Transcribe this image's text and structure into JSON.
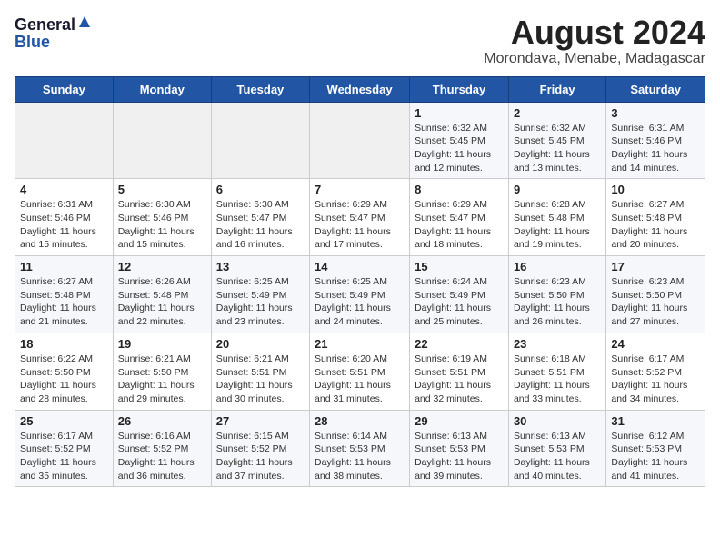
{
  "logo": {
    "general": "General",
    "blue": "Blue"
  },
  "title": "August 2024",
  "subtitle": "Morondava, Menabe, Madagascar",
  "headers": [
    "Sunday",
    "Monday",
    "Tuesday",
    "Wednesday",
    "Thursday",
    "Friday",
    "Saturday"
  ],
  "weeks": [
    [
      {
        "num": "",
        "info": ""
      },
      {
        "num": "",
        "info": ""
      },
      {
        "num": "",
        "info": ""
      },
      {
        "num": "",
        "info": ""
      },
      {
        "num": "1",
        "info": "Sunrise: 6:32 AM\nSunset: 5:45 PM\nDaylight: 11 hours and 12 minutes."
      },
      {
        "num": "2",
        "info": "Sunrise: 6:32 AM\nSunset: 5:45 PM\nDaylight: 11 hours and 13 minutes."
      },
      {
        "num": "3",
        "info": "Sunrise: 6:31 AM\nSunset: 5:46 PM\nDaylight: 11 hours and 14 minutes."
      }
    ],
    [
      {
        "num": "4",
        "info": "Sunrise: 6:31 AM\nSunset: 5:46 PM\nDaylight: 11 hours and 15 minutes."
      },
      {
        "num": "5",
        "info": "Sunrise: 6:30 AM\nSunset: 5:46 PM\nDaylight: 11 hours and 15 minutes."
      },
      {
        "num": "6",
        "info": "Sunrise: 6:30 AM\nSunset: 5:47 PM\nDaylight: 11 hours and 16 minutes."
      },
      {
        "num": "7",
        "info": "Sunrise: 6:29 AM\nSunset: 5:47 PM\nDaylight: 11 hours and 17 minutes."
      },
      {
        "num": "8",
        "info": "Sunrise: 6:29 AM\nSunset: 5:47 PM\nDaylight: 11 hours and 18 minutes."
      },
      {
        "num": "9",
        "info": "Sunrise: 6:28 AM\nSunset: 5:48 PM\nDaylight: 11 hours and 19 minutes."
      },
      {
        "num": "10",
        "info": "Sunrise: 6:27 AM\nSunset: 5:48 PM\nDaylight: 11 hours and 20 minutes."
      }
    ],
    [
      {
        "num": "11",
        "info": "Sunrise: 6:27 AM\nSunset: 5:48 PM\nDaylight: 11 hours and 21 minutes."
      },
      {
        "num": "12",
        "info": "Sunrise: 6:26 AM\nSunset: 5:48 PM\nDaylight: 11 hours and 22 minutes."
      },
      {
        "num": "13",
        "info": "Sunrise: 6:25 AM\nSunset: 5:49 PM\nDaylight: 11 hours and 23 minutes."
      },
      {
        "num": "14",
        "info": "Sunrise: 6:25 AM\nSunset: 5:49 PM\nDaylight: 11 hours and 24 minutes."
      },
      {
        "num": "15",
        "info": "Sunrise: 6:24 AM\nSunset: 5:49 PM\nDaylight: 11 hours and 25 minutes."
      },
      {
        "num": "16",
        "info": "Sunrise: 6:23 AM\nSunset: 5:50 PM\nDaylight: 11 hours and 26 minutes."
      },
      {
        "num": "17",
        "info": "Sunrise: 6:23 AM\nSunset: 5:50 PM\nDaylight: 11 hours and 27 minutes."
      }
    ],
    [
      {
        "num": "18",
        "info": "Sunrise: 6:22 AM\nSunset: 5:50 PM\nDaylight: 11 hours and 28 minutes."
      },
      {
        "num": "19",
        "info": "Sunrise: 6:21 AM\nSunset: 5:50 PM\nDaylight: 11 hours and 29 minutes."
      },
      {
        "num": "20",
        "info": "Sunrise: 6:21 AM\nSunset: 5:51 PM\nDaylight: 11 hours and 30 minutes."
      },
      {
        "num": "21",
        "info": "Sunrise: 6:20 AM\nSunset: 5:51 PM\nDaylight: 11 hours and 31 minutes."
      },
      {
        "num": "22",
        "info": "Sunrise: 6:19 AM\nSunset: 5:51 PM\nDaylight: 11 hours and 32 minutes."
      },
      {
        "num": "23",
        "info": "Sunrise: 6:18 AM\nSunset: 5:51 PM\nDaylight: 11 hours and 33 minutes."
      },
      {
        "num": "24",
        "info": "Sunrise: 6:17 AM\nSunset: 5:52 PM\nDaylight: 11 hours and 34 minutes."
      }
    ],
    [
      {
        "num": "25",
        "info": "Sunrise: 6:17 AM\nSunset: 5:52 PM\nDaylight: 11 hours and 35 minutes."
      },
      {
        "num": "26",
        "info": "Sunrise: 6:16 AM\nSunset: 5:52 PM\nDaylight: 11 hours and 36 minutes."
      },
      {
        "num": "27",
        "info": "Sunrise: 6:15 AM\nSunset: 5:52 PM\nDaylight: 11 hours and 37 minutes."
      },
      {
        "num": "28",
        "info": "Sunrise: 6:14 AM\nSunset: 5:53 PM\nDaylight: 11 hours and 38 minutes."
      },
      {
        "num": "29",
        "info": "Sunrise: 6:13 AM\nSunset: 5:53 PM\nDaylight: 11 hours and 39 minutes."
      },
      {
        "num": "30",
        "info": "Sunrise: 6:13 AM\nSunset: 5:53 PM\nDaylight: 11 hours and 40 minutes."
      },
      {
        "num": "31",
        "info": "Sunrise: 6:12 AM\nSunset: 5:53 PM\nDaylight: 11 hours and 41 minutes."
      }
    ]
  ]
}
